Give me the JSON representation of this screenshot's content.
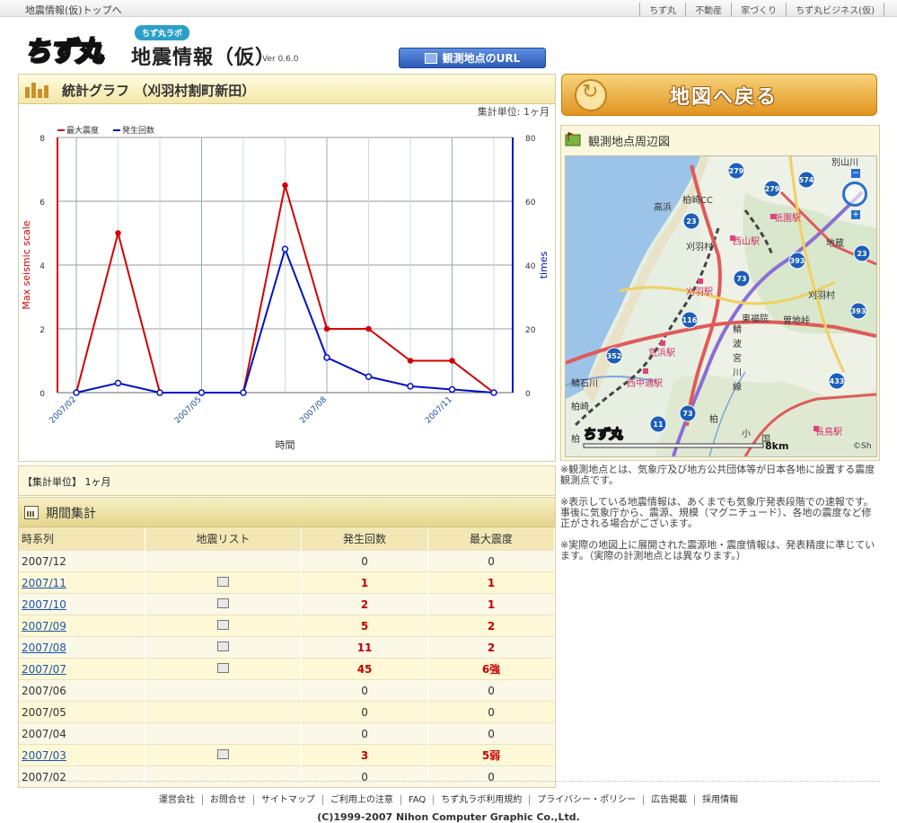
{
  "topbar": {
    "breadcrumb": "地震情報(仮)トップへ",
    "links": [
      "ちず丸",
      "不動産",
      "家づくり",
      "ちず丸ビジネス(仮)"
    ]
  },
  "header": {
    "logo_text": "ちず丸",
    "labo_badge": "ちず丸ラボ",
    "title": "地震情報（仮）",
    "version": "Ver 0.6.0",
    "url_button": "観測地点のURL"
  },
  "graph": {
    "title": "統計グラフ （刈羽村割町新田）",
    "unit_label": "集計単位: 1ヶ月"
  },
  "chart_data": {
    "type": "line",
    "x": [
      "2007/02",
      "2007/03",
      "2007/04",
      "2007/05",
      "2007/06",
      "2007/07",
      "2007/08",
      "2007/09",
      "2007/10",
      "2007/11",
      "2007/12"
    ],
    "x_tick_labels": [
      "2007/02",
      "2007/05",
      "2007/08",
      "2007/11"
    ],
    "xlabel": "時間",
    "ylabel_left": "Max seismic scale",
    "ylabel_right": "times",
    "ylim_left": [
      0,
      8
    ],
    "ylim_right": [
      0,
      80
    ],
    "yticks_left": [
      0,
      2,
      4,
      6,
      8
    ],
    "yticks_right": [
      0,
      20,
      40,
      60,
      80
    ],
    "grid": true,
    "legend_position": "top-left",
    "series": [
      {
        "name": "最大震度",
        "axis": "left",
        "color": "#d40000",
        "values": [
          0,
          5,
          0,
          0,
          0,
          6.5,
          2,
          2,
          1,
          1,
          0
        ]
      },
      {
        "name": "発生回数",
        "axis": "right",
        "color": "#0010c8",
        "values": [
          0,
          3,
          0,
          0,
          0,
          45,
          11,
          5,
          2,
          1,
          0
        ]
      }
    ]
  },
  "unit_bar": "【集計単位】 1ヶ月",
  "period": {
    "title": "期間集計",
    "columns": [
      "時系列",
      "地震リスト",
      "発生回数",
      "最大震度"
    ],
    "rows": [
      {
        "period": "2007/12",
        "link": false,
        "count": "0",
        "max": "0"
      },
      {
        "period": "2007/11",
        "link": true,
        "count": "1",
        "max": "1"
      },
      {
        "period": "2007/10",
        "link": true,
        "count": "2",
        "max": "1"
      },
      {
        "period": "2007/09",
        "link": true,
        "count": "5",
        "max": "2"
      },
      {
        "period": "2007/08",
        "link": true,
        "count": "11",
        "max": "2"
      },
      {
        "period": "2007/07",
        "link": true,
        "count": "45",
        "max": "6強"
      },
      {
        "period": "2007/06",
        "link": false,
        "count": "0",
        "max": "0"
      },
      {
        "period": "2007/05",
        "link": false,
        "count": "0",
        "max": "0"
      },
      {
        "period": "2007/04",
        "link": false,
        "count": "0",
        "max": "0"
      },
      {
        "period": "2007/03",
        "link": true,
        "count": "3",
        "max": "5弱"
      },
      {
        "period": "2007/02",
        "link": false,
        "count": "0",
        "max": "0"
      }
    ]
  },
  "back_button": "地図へ戻る",
  "map": {
    "title": "観測地点周辺図",
    "scale": "8km",
    "copyright": "©Sh",
    "logo": "ちず丸",
    "labels": [
      "別山川",
      "高浜",
      "柏崎CC",
      "祇園駅",
      "西山駅",
      "地蔵",
      "刈羽村",
      "刈羽駅",
      "東福院",
      "曽地峠",
      "刈羽村",
      "荒浜駅",
      "西中通駅",
      "柏崎",
      "鯖石川",
      "柏",
      "長鳥駅",
      "鯖",
      "波",
      "宮",
      "川",
      "線",
      "柏",
      "小",
      "国"
    ],
    "route_numbers": [
      "279",
      "279",
      "574",
      "23",
      "393",
      "23",
      "73",
      "116",
      "393",
      "352",
      "433",
      "73",
      "11"
    ]
  },
  "notes": [
    "※観測地点とは、気象庁及び地方公共団体等が日本各地に設置する震度観測点です。",
    "※表示している地震情報は、あくまでも気象庁発表段階での速報です。事後に気象庁から、震源、規模（マグニチュード）、各地の震度など修正がされる場合がございます。",
    "※実際の地図上に展開された震源地・震度情報は、発表精度に準じています。（実際の計測地点とは異なります。）"
  ],
  "footer": {
    "links": [
      "運営会社",
      "お問合せ",
      "サイトマップ",
      "ご利用上の注意",
      "FAQ",
      "ちず丸ラボ利用規約",
      "プライバシー・ポリシー",
      "広告掲載",
      "採用情報"
    ],
    "copyright": "(C)1999-2007 Nihon Computer Graphic Co.,Ltd."
  }
}
